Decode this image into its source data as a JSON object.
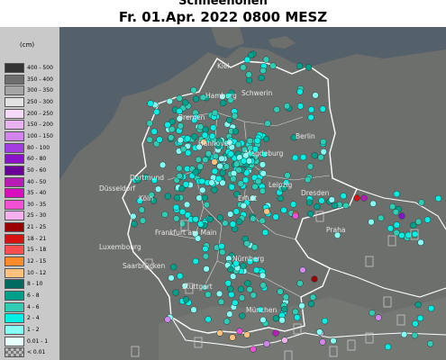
{
  "title_line1": "Schneehöhen",
  "title_line2": "Fr. 01.Apr. 2022 0800 MESZ",
  "legend": {
    "unit": "(cm)",
    "classes": [
      {
        "label": "400 - 500",
        "color": "#333333"
      },
      {
        "label": "350 - 400",
        "color": "#6e6e6e"
      },
      {
        "label": "300 - 350",
        "color": "#a5a5a5"
      },
      {
        "label": "250 - 300",
        "color": "#e2e2e2"
      },
      {
        "label": "200 - 250",
        "color": "#f4daf6"
      },
      {
        "label": "150 - 200",
        "color": "#e7b2f0"
      },
      {
        "label": "100 - 150",
        "color": "#d285ec"
      },
      {
        "label": "80 - 100",
        "color": "#a33fe2"
      },
      {
        "label": "60 - 80",
        "color": "#8a12c8"
      },
      {
        "label": "50 - 60",
        "color": "#6a0098"
      },
      {
        "label": "40 - 50",
        "color": "#b71cb4"
      },
      {
        "label": "35 - 40",
        "color": "#d80fbf"
      },
      {
        "label": "30 - 35",
        "color": "#f14fd4"
      },
      {
        "label": "25 - 30",
        "color": "#f7b0ee"
      },
      {
        "label": "21 - 25",
        "color": "#9a0000"
      },
      {
        "label": "18 - 21",
        "color": "#d61212"
      },
      {
        "label": "15 - 18",
        "color": "#ff4f4f"
      },
      {
        "label": "12 - 15",
        "color": "#ff8a2a"
      },
      {
        "label": "10 - 12",
        "color": "#ffc27e"
      },
      {
        "label": "8 - 10",
        "color": "#006b5e"
      },
      {
        "label": "6 - 8",
        "color": "#00a08a"
      },
      {
        "label": "4 - 6",
        "color": "#32cbb4"
      },
      {
        "label": "2 - 4",
        "color": "#00f0e4"
      },
      {
        "label": "1 - 2",
        "color": "#87fff5"
      },
      {
        "label": "0.01 - 1",
        "color": "#e6fffd"
      },
      {
        "label": "< 0.01",
        "color": "#9a9a9a"
      }
    ]
  },
  "map": {
    "sea_color": "#54606a",
    "land_color": "#6d6f6c",
    "border_color": "#ffffff",
    "cities": {
      "kiel": "Kiel",
      "hamburg": "Hamburg",
      "schwerin": "Schwerin",
      "bremen": "Bremen",
      "berlin": "Berlin",
      "hannover": "Hannover",
      "magdeburg": "Magdeburg",
      "dortmund": "Dortmund",
      "duesseldorf": "Düsseldorf",
      "koeln": "Köln",
      "leipzig": "Leipzig",
      "erfurt": "Erfurt",
      "dresden": "Dresden",
      "frankfurt": "Frankfurt am Main",
      "prag": "Praha",
      "luxembourg": "Luxembourg",
      "saarbruecken": "Saarbrücken",
      "nuernberg": "Nürnberg",
      "stuttgart": "Stuttgart",
      "muenchen": "München"
    }
  }
}
